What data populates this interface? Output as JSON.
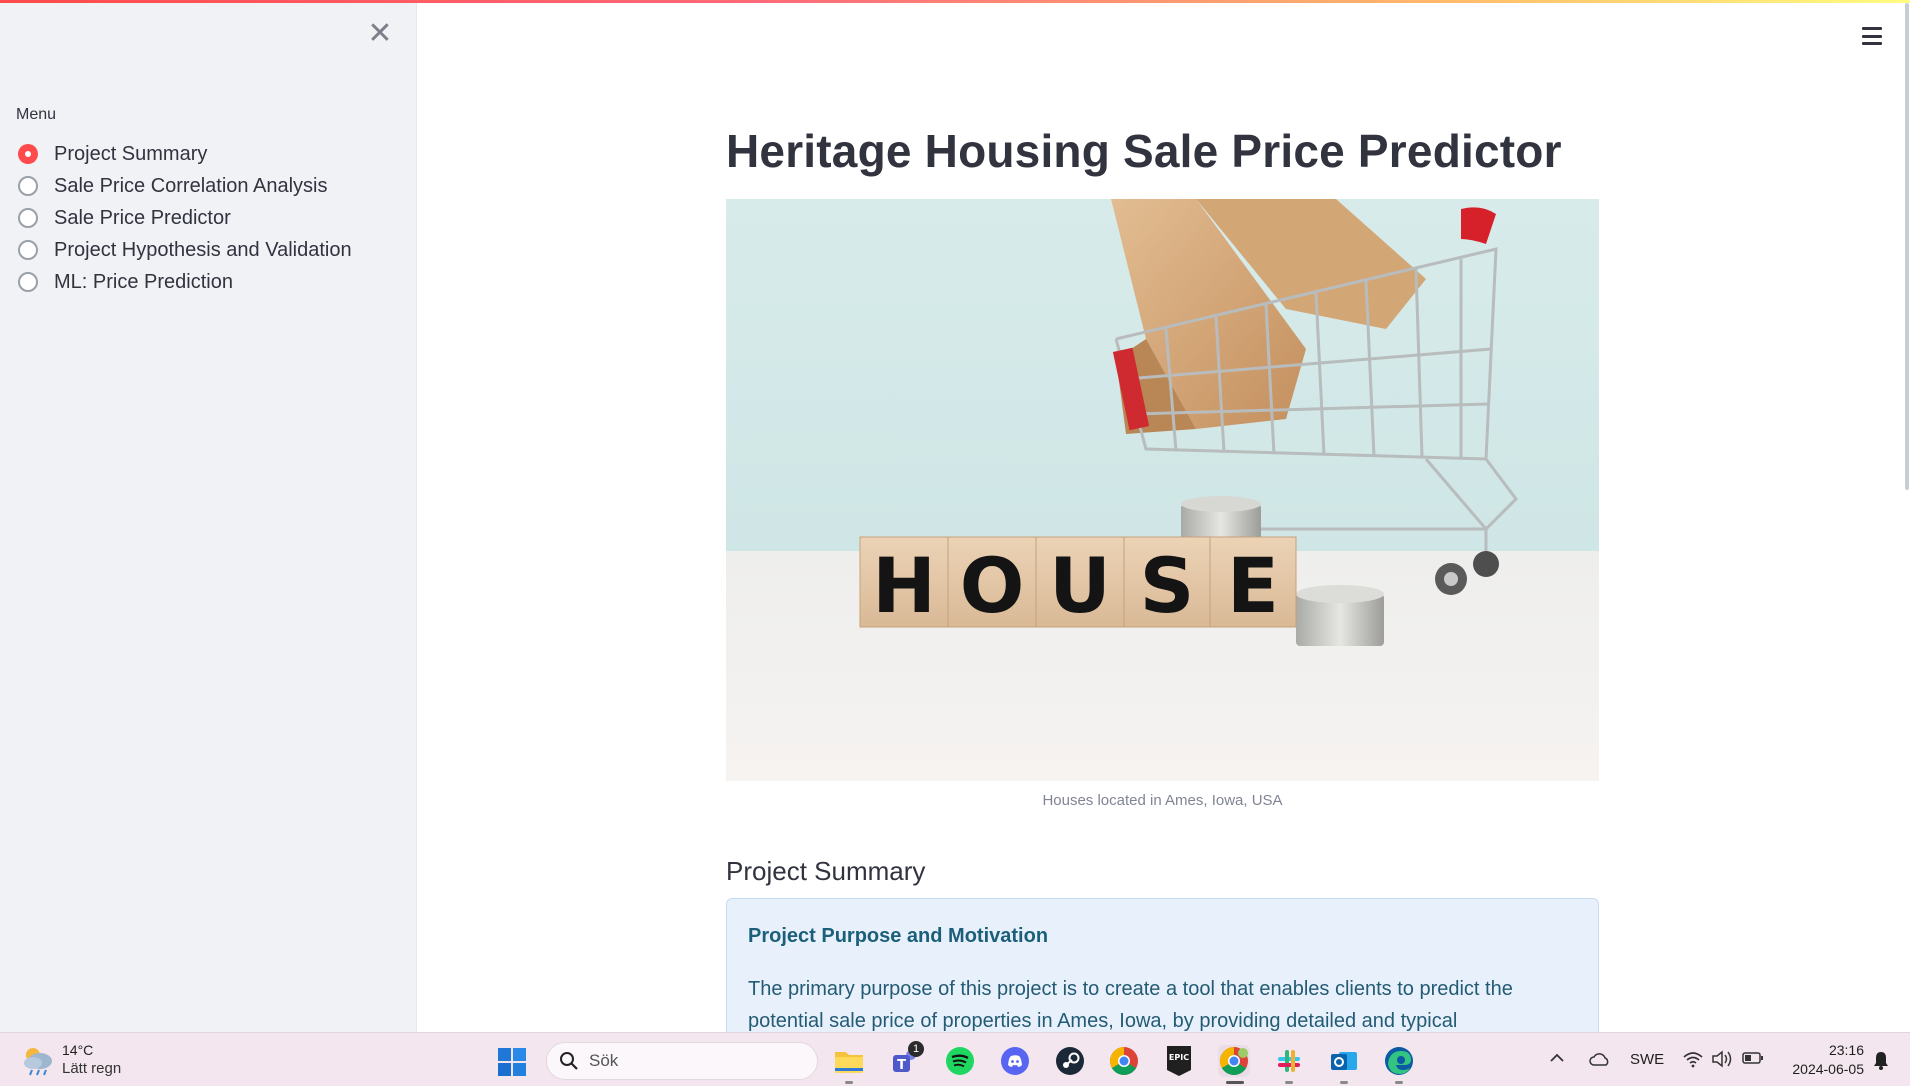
{
  "sidebar": {
    "close_label": "✕",
    "menu_label": "Menu",
    "items": [
      {
        "label": "Project Summary",
        "selected": true
      },
      {
        "label": "Sale Price Correlation Analysis",
        "selected": false
      },
      {
        "label": "Sale Price Predictor",
        "selected": false
      },
      {
        "label": "Project Hypothesis and Validation",
        "selected": false
      },
      {
        "label": "ML: Price Prediction",
        "selected": false
      }
    ]
  },
  "main": {
    "title": "Heritage Housing Sale Price Predictor",
    "hero_letters": [
      "H",
      "O",
      "U",
      "S",
      "E"
    ],
    "image_caption": "Houses located in Ames, Iowa, USA",
    "section_title": "Project Summary",
    "info_box": {
      "heading": "Project Purpose and Motivation",
      "text": "The primary purpose of this project is to create a tool that enables clients to predict the potential sale price of properties in Ames, Iowa, by providing detailed and typical"
    }
  },
  "colors": {
    "accent": "#ff4b4b",
    "sidebar_bg": "#f0f2f6",
    "info_bg": "#e8f1fb",
    "info_text": "#245b74"
  },
  "taskbar": {
    "weather_temp": "14°C",
    "weather_condition": "Lätt regn",
    "search_placeholder": "Sök",
    "teams_badge": "1",
    "apps": [
      "file-explorer-icon",
      "teams-icon",
      "spotify-icon",
      "discord-icon",
      "steam-icon",
      "chrome-icon",
      "epic-games-icon",
      "chrome-profile-icon",
      "slack-icon",
      "outlook-icon",
      "edge-icon"
    ],
    "epic_label": "EPIC",
    "language": "SWE",
    "time": "23:16",
    "date": "2024-06-05"
  }
}
